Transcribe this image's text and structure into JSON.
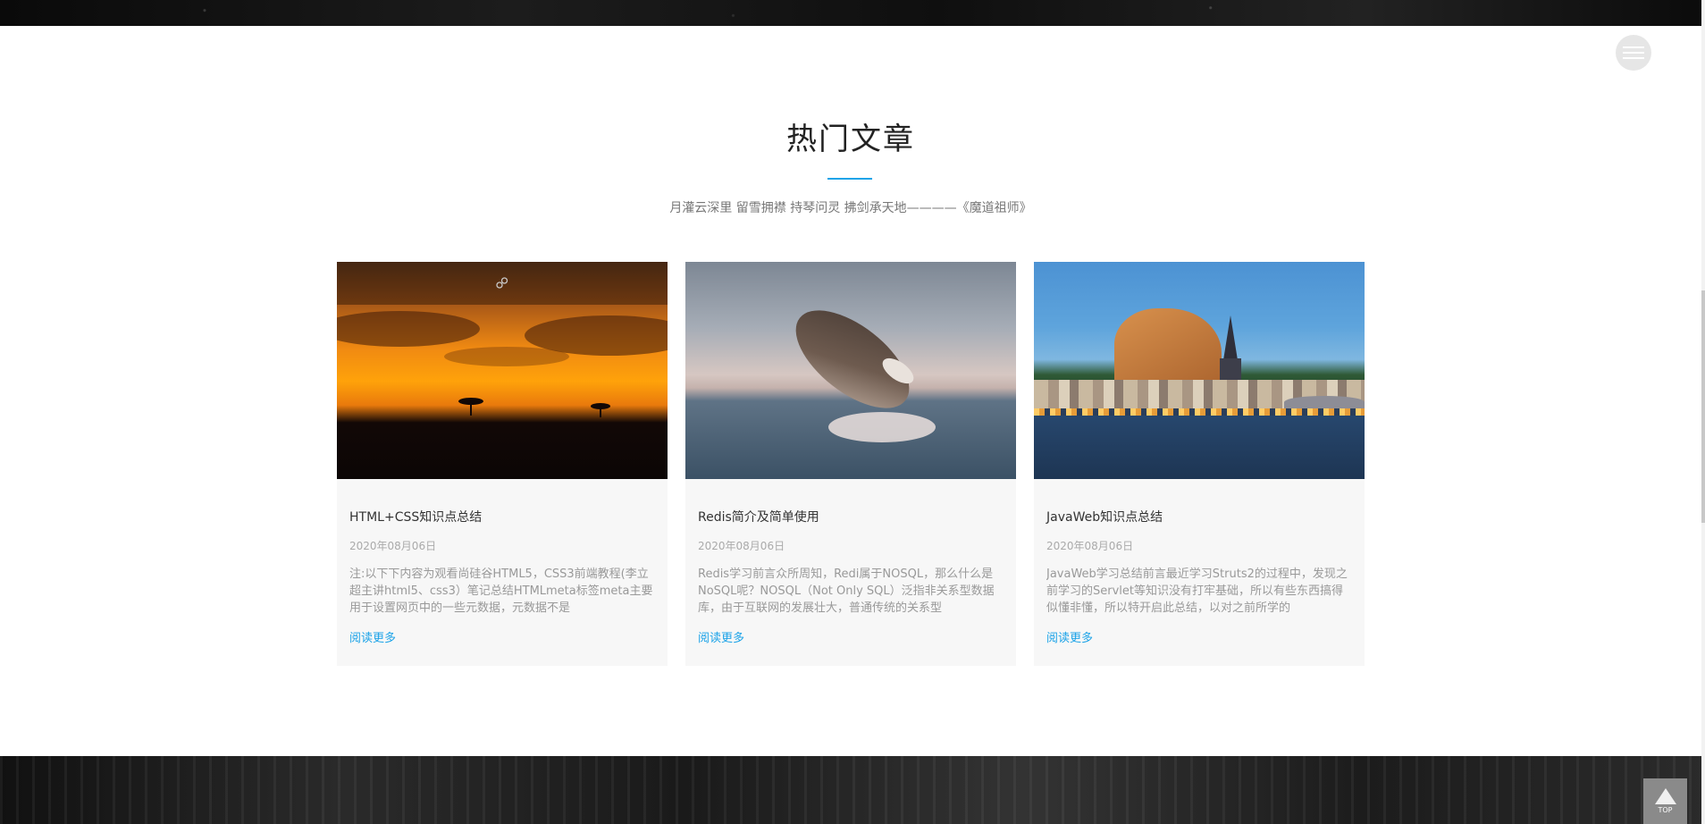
{
  "section": {
    "title": "热门文章",
    "subtitle": "月灌云深里 留雪拥襟 持琴问灵 拂剑承天地————《魔道祖师》",
    "accent_color": "#1ca3e8"
  },
  "articles": [
    {
      "title": "HTML+CSS知识点总结",
      "date": "2020年08月06日",
      "excerpt": "注:以下下内容为观看尚硅谷HTML5，CSS3前端教程(李立超主讲html5、css3）笔记总结HTMLmeta标签meta主要用于设置网页中的一些元数据，元数据不是",
      "read_more": "阅读更多",
      "image": "savanna-sunset"
    },
    {
      "title": "Redis简介及简单使用",
      "date": "2020年08月06日",
      "excerpt": "Redis学习前言众所周知，Redi属于NOSQL，那么什么是NoSQL呢？NOSQL（Not Only SQL）泛指非关系型数据库，由于互联网的发展壮大，普通传统的关系型",
      "read_more": "阅读更多",
      "image": "breaching-whale"
    },
    {
      "title": "JavaWeb知识点总结",
      "date": "2020年08月06日",
      "excerpt": "JavaWeb学习总结前言最近学习Struts2的过程中，发现之前学习的Servlet等知识没有打牢基础，所以有些东西搞得似懂非懂，所以特开启此总结，以对之前所学的",
      "read_more": "阅读更多",
      "image": "riverside-town"
    }
  ],
  "icons": {
    "menu": "hamburger-icon",
    "link": "link-icon",
    "back_to_top": "arrow-up-icon"
  },
  "back_to_top": {
    "label": "TOP"
  }
}
